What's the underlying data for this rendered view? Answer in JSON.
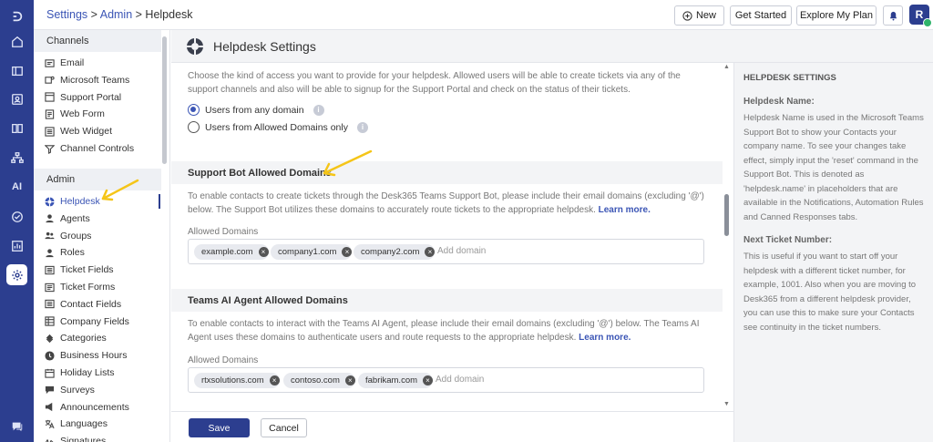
{
  "rail": {
    "ai_label": "AI"
  },
  "topbar": {
    "breadcrumb": {
      "settings": "Settings",
      "sep1": " > ",
      "admin": "Admin",
      "sep2": " > ",
      "current": "Helpdesk"
    },
    "new_label": "New",
    "get_started_label": "Get Started",
    "explore_label": "Explore My Plan",
    "avatar_initial": "R"
  },
  "sidebar": {
    "channels_heading": "Channels",
    "channels": [
      {
        "label": "Email",
        "icon": "mail-icon"
      },
      {
        "label": "Microsoft Teams",
        "icon": "teams-icon"
      },
      {
        "label": "Support Portal",
        "icon": "portal-icon"
      },
      {
        "label": "Web Form",
        "icon": "form-icon"
      },
      {
        "label": "Web Widget",
        "icon": "widget-icon"
      },
      {
        "label": "Channel Controls",
        "icon": "filter-icon"
      }
    ],
    "admin_heading": "Admin",
    "admin": [
      {
        "label": "Helpdesk",
        "icon": "helpdesk-icon",
        "active": true
      },
      {
        "label": "Agents",
        "icon": "agent-icon"
      },
      {
        "label": "Groups",
        "icon": "groups-icon"
      },
      {
        "label": "Roles",
        "icon": "roles-icon"
      },
      {
        "label": "Ticket Fields",
        "icon": "ticket-fields-icon"
      },
      {
        "label": "Ticket Forms",
        "icon": "ticket-forms-icon"
      },
      {
        "label": "Contact Fields",
        "icon": "contact-fields-icon"
      },
      {
        "label": "Company Fields",
        "icon": "company-fields-icon"
      },
      {
        "label": "Categories",
        "icon": "categories-icon"
      },
      {
        "label": "Business Hours",
        "icon": "clock-icon"
      },
      {
        "label": "Holiday Lists",
        "icon": "calendar-icon"
      },
      {
        "label": "Surveys",
        "icon": "survey-icon"
      },
      {
        "label": "Announcements",
        "icon": "announcement-icon"
      },
      {
        "label": "Languages",
        "icon": "language-icon"
      },
      {
        "label": "Signatures",
        "icon": "signature-icon"
      }
    ]
  },
  "main": {
    "title": "Helpdesk Settings",
    "access_desc": "Choose the kind of access you want to provide for your helpdesk. Allowed users will be able to create tickets via any of the support channels and also will be able to signup for the Support Portal and check on the status of their tickets.",
    "radio_any": "Users from any domain",
    "radio_allowed": "Users from Allowed Domains only",
    "info_glyph": "i",
    "bot_heading": "Support Bot Allowed Domains",
    "bot_desc": "To enable contacts to create tickets through the Desk365 Teams Support Bot, please include their email domains (excluding '@') below. The Support Bot utilizes these domains to accurately route tickets to the appropriate helpdesk.",
    "learn_more": "Learn more.",
    "allowed_domains_label": "Allowed Domains",
    "bot_domains": [
      "example.com",
      "company1.com",
      "company2.com"
    ],
    "add_domain_placeholder": "Add domain",
    "ai_heading": "Teams AI Agent Allowed Domains",
    "ai_desc": "To enable contacts to interact with the Teams AI Agent, please include their email domains (excluding '@') below. The Teams AI Agent uses these domains to authenticate users and route requests to the appropriate helpdesk.",
    "ai_domains": [
      "rtxsolutions.com",
      "contoso.com",
      "fabrikam.com"
    ],
    "chip_remove": "×"
  },
  "footer": {
    "save_label": "Save",
    "cancel_label": "Cancel"
  },
  "help_panel": {
    "heading": "HELPDESK SETTINGS",
    "name_title": "Helpdesk Name:",
    "name_text": "Helpdesk Name is used in the Microsoft Teams Support Bot to show your Contacts your company name. To see your changes take effect, simply input the 'reset' command in the Support Bot. This is denoted as 'helpdesk.name' in placeholders that are available in the Notifications, Automation Rules and Canned Responses tabs.",
    "next_title": "Next Ticket Number:",
    "next_text": "This is useful if you want to start off your helpdesk with a different ticket number, for example, 1001. Also when you are moving to Desk365 from a different helpdesk provider, you can use this to make sure your Contacts see continuity in the ticket numbers."
  },
  "colors": {
    "rail": "#2c3e8f",
    "accent": "#3b55b5",
    "annotation": "#f5c518"
  }
}
